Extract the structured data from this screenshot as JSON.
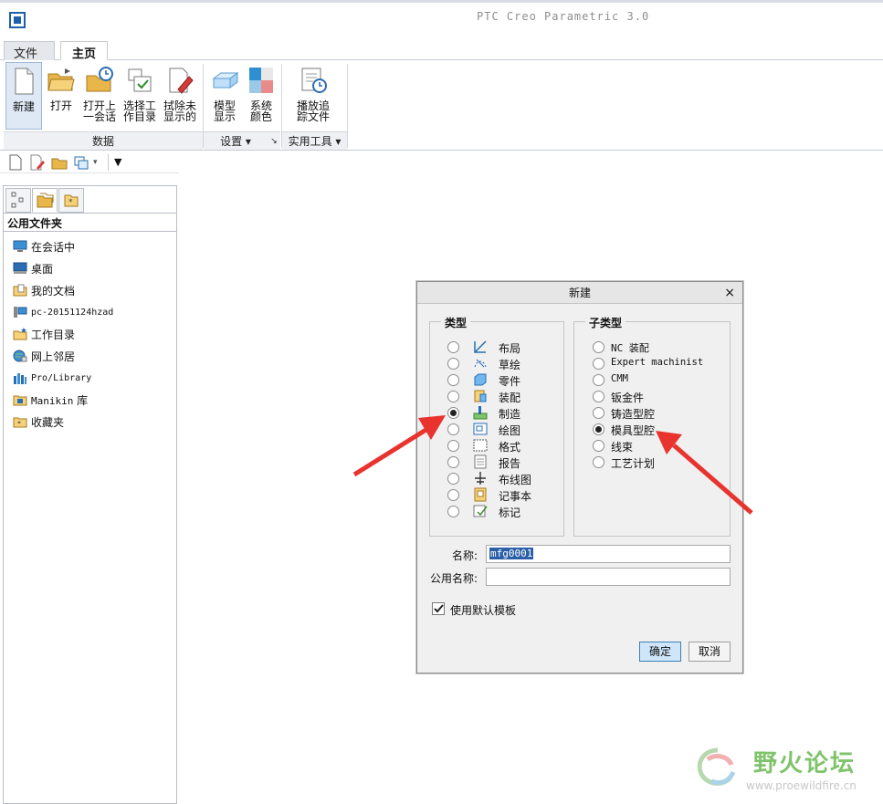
{
  "app": {
    "title": "PTC Creo Parametric 3.0"
  },
  "ribbon": {
    "tabs": [
      {
        "label": "文件",
        "dropdown": "▾"
      },
      {
        "label": "主页"
      }
    ],
    "buttons": {
      "new": "新建",
      "open": "打开",
      "open_last_line1": "打开上",
      "open_last_line2": "一会话",
      "select_wd_line1": "选择工",
      "select_wd_line2": "作目录",
      "erase_line1": "拭除未",
      "erase_line2": "显示的",
      "model_display_line1": "模型",
      "model_display_line2": "显示",
      "system_colors_line1": "系统",
      "system_colors_line2": "颜色",
      "play_trail_line1": "播放追",
      "play_trail_line2": "踪文件"
    },
    "groups": {
      "data": "数据",
      "settings": "设置 ▾",
      "utilities": "实用工具 ▾"
    }
  },
  "navigator": {
    "header": "公用文件夹",
    "items": [
      {
        "label": "在会话中",
        "icon": "monitor-icon"
      },
      {
        "label": "桌面",
        "icon": "desktop-icon"
      },
      {
        "label": "我的文档",
        "icon": "documents-icon"
      },
      {
        "label": "pc-20151124hzad",
        "icon": "computer-icon"
      },
      {
        "label": "工作目录",
        "icon": "folder-star-icon"
      },
      {
        "label": "网上邻居",
        "icon": "network-icon"
      },
      {
        "label": "Pro/Library",
        "icon": "library-icon"
      },
      {
        "label": "Manikin 库",
        "icon": "manikin-icon"
      },
      {
        "label": "收藏夹",
        "icon": "favorites-icon"
      }
    ]
  },
  "dialog": {
    "title": "新建",
    "close": "×",
    "type_legend": "类型",
    "subtype_legend": "子类型",
    "types": [
      {
        "label": "布局",
        "checked": false
      },
      {
        "label": "草绘",
        "checked": false
      },
      {
        "label": "零件",
        "checked": false
      },
      {
        "label": "装配",
        "checked": false
      },
      {
        "label": "制造",
        "checked": true
      },
      {
        "label": "绘图",
        "checked": false
      },
      {
        "label": "格式",
        "checked": false
      },
      {
        "label": "报告",
        "checked": false
      },
      {
        "label": "布线图",
        "checked": false
      },
      {
        "label": "记事本",
        "checked": false
      },
      {
        "label": "标记",
        "checked": false
      }
    ],
    "subtypes": [
      {
        "label": "NC 装配",
        "checked": false
      },
      {
        "label": "Expert machinist",
        "checked": false
      },
      {
        "label": "CMM",
        "checked": false
      },
      {
        "label": "钣金件",
        "checked": false
      },
      {
        "label": "铸造型腔",
        "checked": false
      },
      {
        "label": "模具型腔",
        "checked": true
      },
      {
        "label": "线束",
        "checked": false
      },
      {
        "label": "工艺计划",
        "checked": false
      }
    ],
    "name_label": "名称:",
    "name_value": "mfg0001",
    "common_name_label": "公用名称:",
    "common_name_value": "",
    "use_default_template": "使用默认模板",
    "ok": "确定",
    "cancel": "取消"
  },
  "watermark": {
    "text": "野火论坛",
    "url": "www.proewildfire.cn"
  },
  "colors": {
    "accent_blue": "#1d5fa8",
    "arrow_red": "#e8332e",
    "watermark_green": "#7fc36b"
  }
}
